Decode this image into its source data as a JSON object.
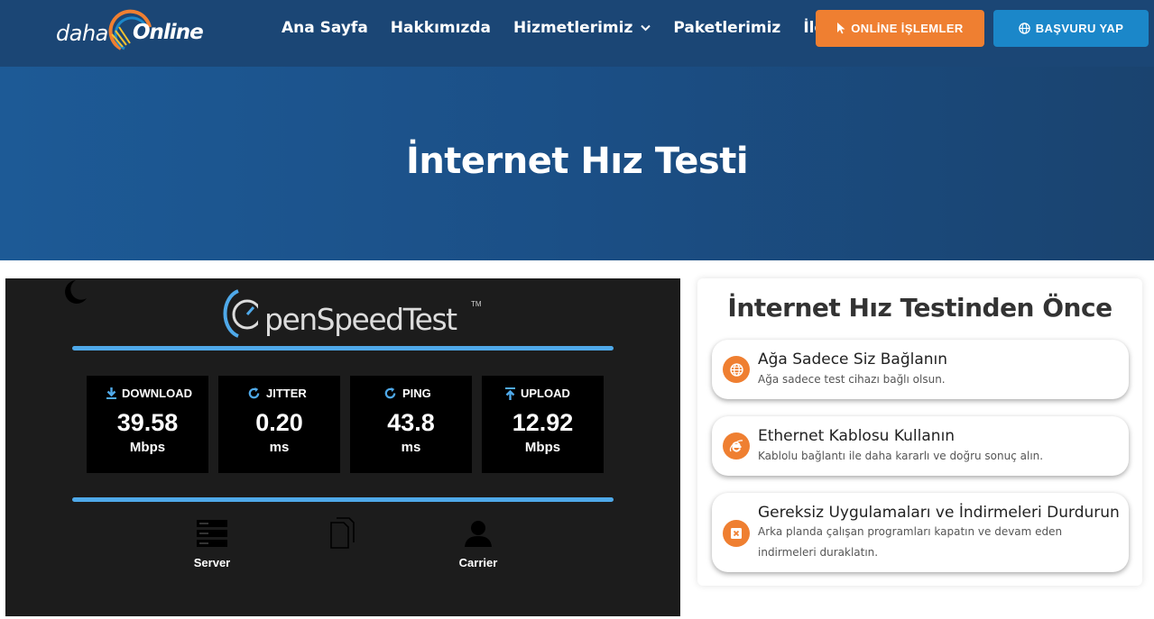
{
  "nav": {
    "logo_daha": "daha",
    "logo_online": "Online",
    "items": [
      {
        "label": "Ana Sayfa"
      },
      {
        "label": "Hakkımızda"
      },
      {
        "label": "Hizmetlerimiz",
        "has_dropdown": true
      },
      {
        "label": "Paketlerimiz"
      },
      {
        "label": "İletişim"
      }
    ],
    "online_button": "ONLİNE İŞLEMLER",
    "apply_button": "BAŞVURU YAP",
    "colors": {
      "navbar": "#1b4675",
      "orange": "#ef7f31",
      "blue": "#1b87c9"
    }
  },
  "hero": {
    "title": "İnternet Hız Testi"
  },
  "speedtest": {
    "logo_text": "penSpeedTest",
    "logo_tm": "TM",
    "metrics": [
      {
        "label": "DOWNLOAD",
        "value": "39.58",
        "unit": "Mbps",
        "icon": "download-arrow-icon"
      },
      {
        "label": "JITTER",
        "value": "0.20",
        "unit": "ms",
        "icon": "refresh-icon"
      },
      {
        "label": "PING",
        "value": "43.8",
        "unit": "ms",
        "icon": "refresh-icon"
      },
      {
        "label": "UPLOAD",
        "value": "12.92",
        "unit": "Mbps",
        "icon": "upload-arrow-icon"
      }
    ],
    "server_label": "Server",
    "carrier_label": "Carrier"
  },
  "info": {
    "title": "İnternet Hız Testinden Önce",
    "tips": [
      {
        "title": "Ağa Sadece Siz Bağlanın",
        "desc": "Ağa sadece test cihazı bağlı olsun.",
        "icon": "globe-icon"
      },
      {
        "title": "Ethernet Kablosu Kullanın",
        "desc": "Kablolu bağlantı ile daha kararlı ve doğru sonuç alın.",
        "icon": "internet-explorer-icon"
      },
      {
        "title": "Gereksiz Uygulamaları ve İndirmeleri Durdurun",
        "desc": "Arka planda çalışan programları kapatın ve devam eden indirmeleri duraklatın.",
        "icon": "close-box-icon"
      }
    ]
  }
}
